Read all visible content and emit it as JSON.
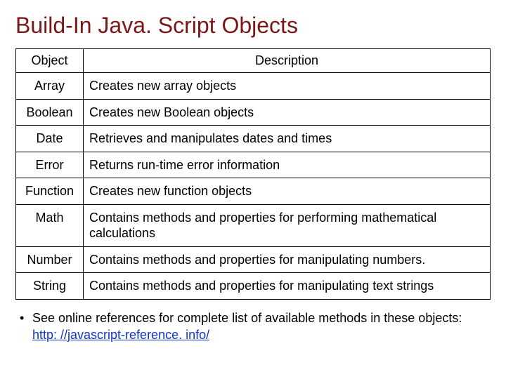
{
  "title": "Build-In Java. Script Objects",
  "table": {
    "headers": {
      "object": "Object",
      "description": "Description"
    },
    "rows": [
      {
        "object": "Array",
        "description": "Creates new array objects"
      },
      {
        "object": "Boolean",
        "description": "Creates new Boolean objects"
      },
      {
        "object": "Date",
        "description": "Retrieves and manipulates dates and times"
      },
      {
        "object": "Error",
        "description": "Returns run-time error information"
      },
      {
        "object": "Function",
        "description": "Creates new function objects"
      },
      {
        "object": "Math",
        "description": "Contains methods and properties for performing mathematical calculations"
      },
      {
        "object": "Number",
        "description": "Contains methods and properties for manipulating numbers."
      },
      {
        "object": "String",
        "description": "Contains methods and properties for manipulating text strings"
      }
    ]
  },
  "footnote": {
    "bullet": "•",
    "text": "See online references for complete list of available methods in these objects: ",
    "link_text": "http: //javascript-reference. info/"
  }
}
